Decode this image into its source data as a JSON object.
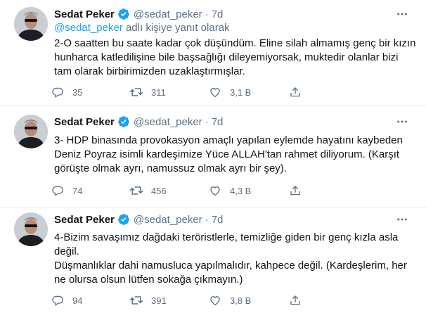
{
  "tweets": [
    {
      "author_name": "Sedat Peker",
      "handle": "@sedat_peker",
      "separator": "·",
      "time": "7d",
      "reply_mention": "@sedat_peker",
      "reply_suffix": "adlı kişiye yanıt olarak",
      "lines": [
        "2-O saatten bu saate kadar çok düşündüm. Eline silah almamış genç bir kızın",
        "hunharca katledilişine bile başsağlığı dileyemiyorsak, muktedir olanlar bizi",
        "tam olarak birbirimizden uzaklaştırmışlar."
      ],
      "replies": "35",
      "retweets": "311",
      "likes": "3,1 B"
    },
    {
      "author_name": "Sedat Peker",
      "handle": "@sedat_peker",
      "separator": "·",
      "time": "7d",
      "lines": [
        "3- HDP binasında provokasyon amaçlı yapılan eylemde hayatını kaybeden",
        "Deniz Poyraz isimli kardeşimize Yüce ALLAH'tan rahmet diliyorum. (Karşıt",
        "görüşte olmak ayrı, namussuz olmak ayrı bir şey)."
      ],
      "replies": "74",
      "retweets": "456",
      "likes": "4,3 B"
    },
    {
      "author_name": "Sedat Peker",
      "handle": "@sedat_peker",
      "separator": "·",
      "time": "7d",
      "lines": [
        "4-Bizim savaşımız dağdaki teröristlerle, temizliğe giden bir genç kızla asla",
        "değil.",
        "Düşmanlıklar dahi namusluca yapılmalıdır, kahpece değil. (Kardeşlerim, her",
        "ne olursa olsun lütfen sokağa çıkmayın.)"
      ],
      "replies": "94",
      "retweets": "391",
      "likes": "3,8 B"
    }
  ],
  "icons": {
    "verified": "verified-badge-icon",
    "more": "more-options-icon",
    "reply": "reply-icon",
    "retweet": "retweet-icon",
    "like": "like-icon",
    "share": "share-icon"
  },
  "colors": {
    "accent": "#1da1f2",
    "secondary_text": "#5b7083",
    "divider": "#e6ecf0"
  }
}
